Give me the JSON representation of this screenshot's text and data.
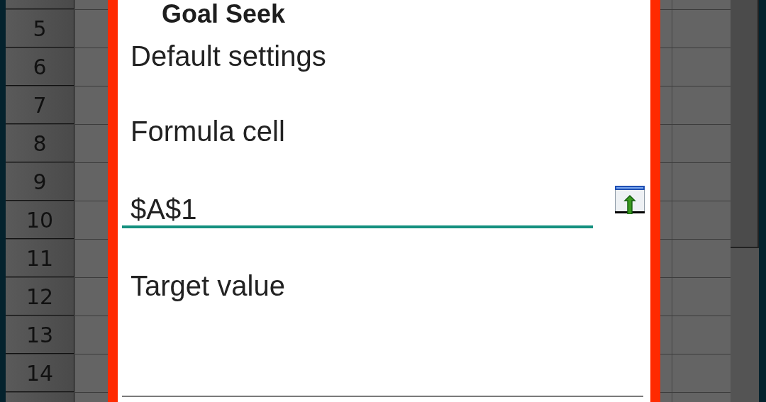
{
  "sheet": {
    "row_numbers": [
      "5",
      "6",
      "7",
      "8",
      "9",
      "10",
      "11",
      "12",
      "13",
      "14"
    ]
  },
  "dialog": {
    "title": "Goal Seek",
    "section": "Default settings",
    "fields": [
      {
        "label": "Formula cell",
        "value": "$A$1",
        "focused": true,
        "kind": "reference"
      },
      {
        "label": "Target value",
        "focused": false,
        "kind": "text"
      }
    ]
  }
}
